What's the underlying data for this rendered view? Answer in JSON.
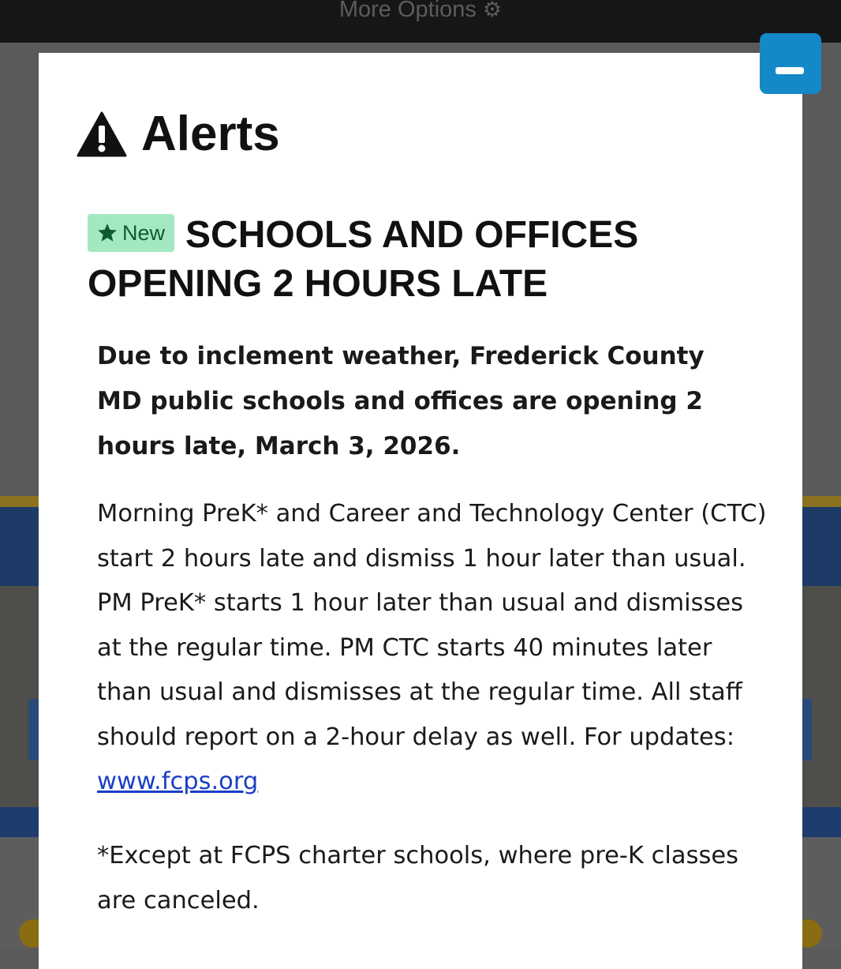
{
  "topbar": {
    "label": "More Options",
    "icon": "gear-icon"
  },
  "modal": {
    "close_icon": "minus-icon",
    "title": "Alerts",
    "title_icon": "warning-triangle-icon",
    "alert": {
      "badge": "New",
      "badge_icon": "star-icon",
      "heading": "SCHOOLS AND OFFICES OPENING 2 HOURS LATE",
      "lead": "Due to inclement weather, Frederick County MD public schools and offices are opening 2 hours late, March 3, 2026.",
      "body": "Morning PreK* and Career and Technology Center (CTC) start 2 hours late and dismiss 1 hour later than usual. PM PreK* starts 1 hour later than usual and dismisses at the regular time. PM CTC starts 40 minutes later than usual and dismisses at the regular time. All staff should report on a 2-hour delay as well. For updates:",
      "link_text": " www.fcps.org ",
      "footnote": "*Except at FCPS charter schools, where pre-K classes are canceled."
    }
  },
  "colors": {
    "close_button": "#1588c8",
    "badge_bg": "#a3e8c1",
    "badge_text": "#0d5a2f",
    "link": "#1b3fc7"
  }
}
